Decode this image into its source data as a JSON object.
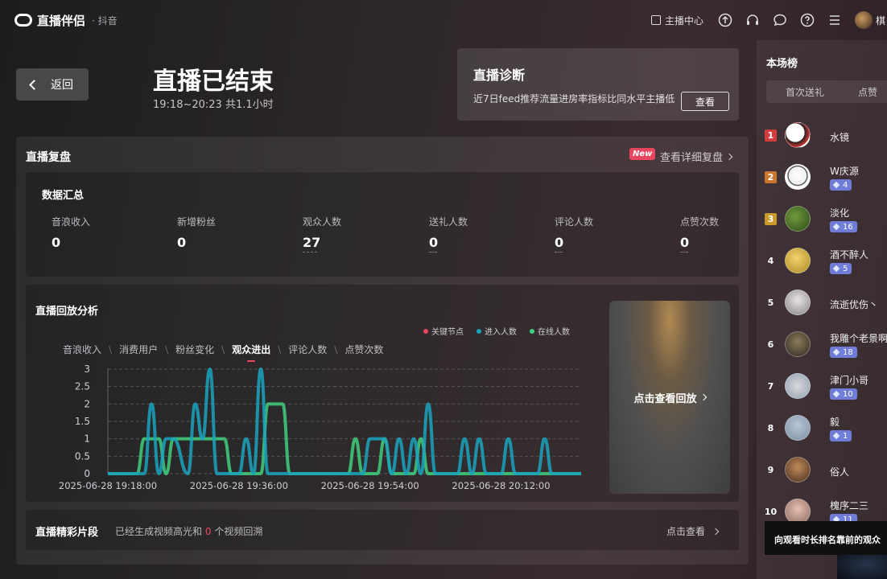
{
  "app": {
    "name": "直播伴侣",
    "sub": "· 抖音"
  },
  "topbar": {
    "anchor_center": "主播中心",
    "user": "棋"
  },
  "header": {
    "back": "返回",
    "title": "直播已结束",
    "subtitle": "19:18~20:23 共1.1小时"
  },
  "diagnosis": {
    "title": "直播诊断",
    "text": "近7日feed推荐流量进房率指标比同水平主播低",
    "button": "查看"
  },
  "review": {
    "title": "直播复盘",
    "badge": "New",
    "detail_link": "查看详细复盘"
  },
  "summary": {
    "title": "数据汇总",
    "stats": [
      {
        "label": "音浪收入",
        "value": "0"
      },
      {
        "label": "新增粉丝",
        "value": "0"
      },
      {
        "label": "观众人数",
        "value": "27"
      },
      {
        "label": "送礼人数",
        "value": "0"
      },
      {
        "label": "评论人数",
        "value": "0"
      },
      {
        "label": "点赞次数",
        "value": "0"
      }
    ]
  },
  "replay": {
    "title": "直播回放分析",
    "legend": [
      "关键节点",
      "进入人数",
      "在线人数"
    ],
    "tabs": [
      "音浪收入",
      "消费用户",
      "粉丝变化",
      "观众进出",
      "评论人数",
      "点赞次数"
    ],
    "active_tab": "观众进出",
    "video_label": "点击查看回放"
  },
  "highlights": {
    "title": "直播精彩片段",
    "desc_pre": "已经生成视频高光和",
    "count": "0",
    "desc_post": "个视频回溯",
    "link": "点击查看"
  },
  "chart_data": {
    "type": "line",
    "x_ticks": [
      "2025-06-28 19:18:00",
      "2025-06-28 19:36:00",
      "2025-06-28 19:54:00",
      "2025-06-28 20:12:00"
    ],
    "x_range": [
      "2025-06-28 19:18:00",
      "2025-06-28 20:23:00"
    ],
    "y_ticks": [
      "0",
      "0.5",
      "1",
      "1.5",
      "2",
      "2.5",
      "3"
    ],
    "ylim": [
      0,
      3
    ],
    "grid": true,
    "series": [
      {
        "name": "进入人数",
        "color": "#1aa3bd",
        "points": [
          [
            0,
            0
          ],
          [
            5,
            0
          ],
          [
            6,
            2
          ],
          [
            7,
            0
          ],
          [
            8,
            1
          ],
          [
            9,
            1
          ],
          [
            11,
            0
          ],
          [
            12,
            2
          ],
          [
            13,
            1
          ],
          [
            14,
            3
          ],
          [
            15,
            0
          ],
          [
            18,
            0
          ],
          [
            19,
            1
          ],
          [
            20,
            0
          ],
          [
            21,
            3
          ],
          [
            22,
            0
          ],
          [
            35,
            0
          ],
          [
            36,
            1
          ],
          [
            37,
            1
          ],
          [
            38,
            1
          ],
          [
            39,
            0
          ],
          [
            40,
            1
          ],
          [
            41,
            0
          ],
          [
            42,
            1
          ],
          [
            43,
            0
          ],
          [
            44,
            2
          ],
          [
            45,
            0
          ],
          [
            48,
            0
          ],
          [
            49,
            1
          ],
          [
            50,
            0
          ],
          [
            51,
            1
          ],
          [
            52,
            0
          ],
          [
            54,
            0
          ],
          [
            55,
            1
          ],
          [
            56,
            0
          ],
          [
            59,
            0
          ],
          [
            60,
            1
          ],
          [
            61,
            0
          ],
          [
            65,
            0
          ]
        ]
      },
      {
        "name": "在线人数",
        "color": "#3fcf7c",
        "points": [
          [
            0,
            0
          ],
          [
            4,
            0
          ],
          [
            5,
            1
          ],
          [
            7,
            1
          ],
          [
            8,
            0
          ],
          [
            9,
            1
          ],
          [
            16,
            1
          ],
          [
            17,
            0
          ],
          [
            21,
            0
          ],
          [
            22,
            2
          ],
          [
            24,
            2
          ],
          [
            25,
            0
          ],
          [
            33,
            0
          ],
          [
            34,
            1
          ],
          [
            35,
            0
          ],
          [
            37,
            0
          ],
          [
            38,
            1
          ],
          [
            39,
            0
          ],
          [
            42,
            0
          ],
          [
            43,
            1
          ],
          [
            44,
            0
          ],
          [
            65,
            0
          ]
        ]
      }
    ],
    "key_nodes_color": "#e8475f"
  },
  "ranking": {
    "title": "本场榜",
    "tabs": [
      "首次送礼",
      "点赞"
    ],
    "items": [
      {
        "rank": "1",
        "name": "水镜",
        "badge": ""
      },
      {
        "rank": "2",
        "name": "W庆源",
        "badge": "4"
      },
      {
        "rank": "3",
        "name": "淡化",
        "badge": "16"
      },
      {
        "rank": "4",
        "name": "酒不醉人",
        "badge": "5"
      },
      {
        "rank": "5",
        "name": "流逝优伤丶",
        "badge": ""
      },
      {
        "rank": "6",
        "name": "我雕个老景啊",
        "badge": "18"
      },
      {
        "rank": "7",
        "name": "津门小哥",
        "badge": "10"
      },
      {
        "rank": "8",
        "name": "毅",
        "badge": "1"
      },
      {
        "rank": "9",
        "name": "俗人",
        "badge": ""
      },
      {
        "rank": "10",
        "name": "槐序二三",
        "badge": "11"
      }
    ]
  },
  "tooltip": "向观看时长排名靠前的观众"
}
